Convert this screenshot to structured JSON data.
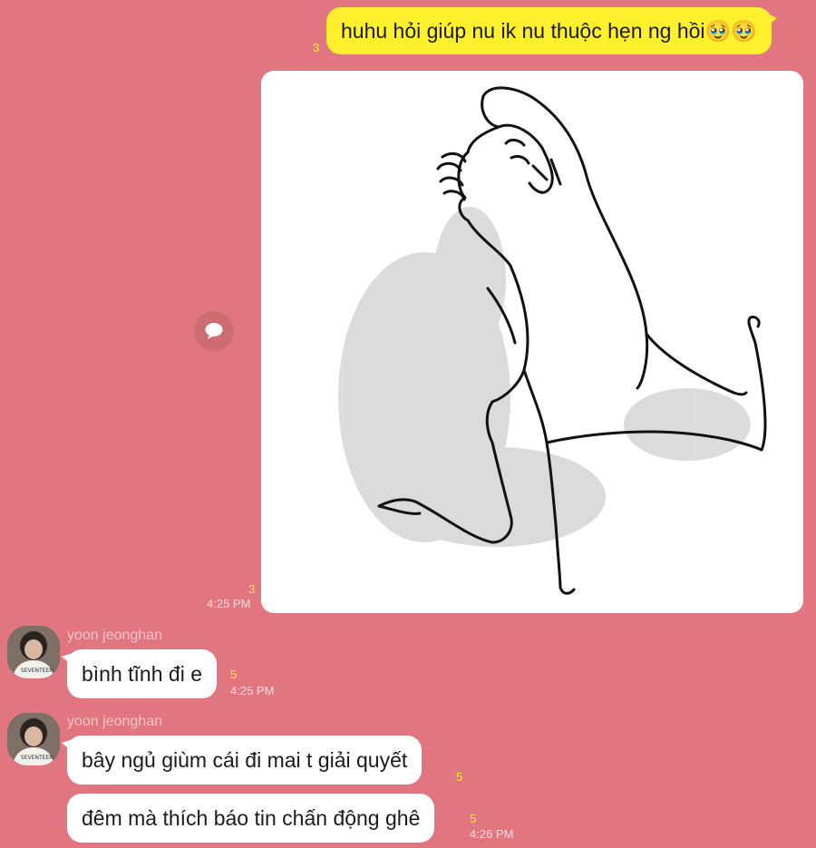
{
  "messages": [
    {
      "type": "outgoing-text",
      "text": "huhu hỏi giúp nu ik nu thuộc hẹn ng hồi🥹🥹",
      "unread": "3"
    },
    {
      "type": "outgoing-image",
      "unread": "3",
      "time": "4:25 PM"
    },
    {
      "type": "incoming-text",
      "sender": "yoon jeonghan",
      "text": "bình tĩnh đi e",
      "unread": "5",
      "time": "4:25 PM"
    },
    {
      "type": "incoming-text",
      "sender": "yoon jeonghan",
      "text": "bây ngủ giùm cái đi mai t giải quyết",
      "unread": "5"
    },
    {
      "type": "incoming-text",
      "text": "đêm mà thích báo tin chấn động ghê",
      "unread": "5",
      "time": "4:26 PM"
    }
  ],
  "avatar_text": "SEVENTEEN",
  "colors": {
    "background": "#e27680",
    "outgoing_bubble": "#fef02d",
    "incoming_bubble": "#ffffff",
    "unread": "#fbee39"
  },
  "icons": {
    "share": "speech-bubble-icon"
  }
}
